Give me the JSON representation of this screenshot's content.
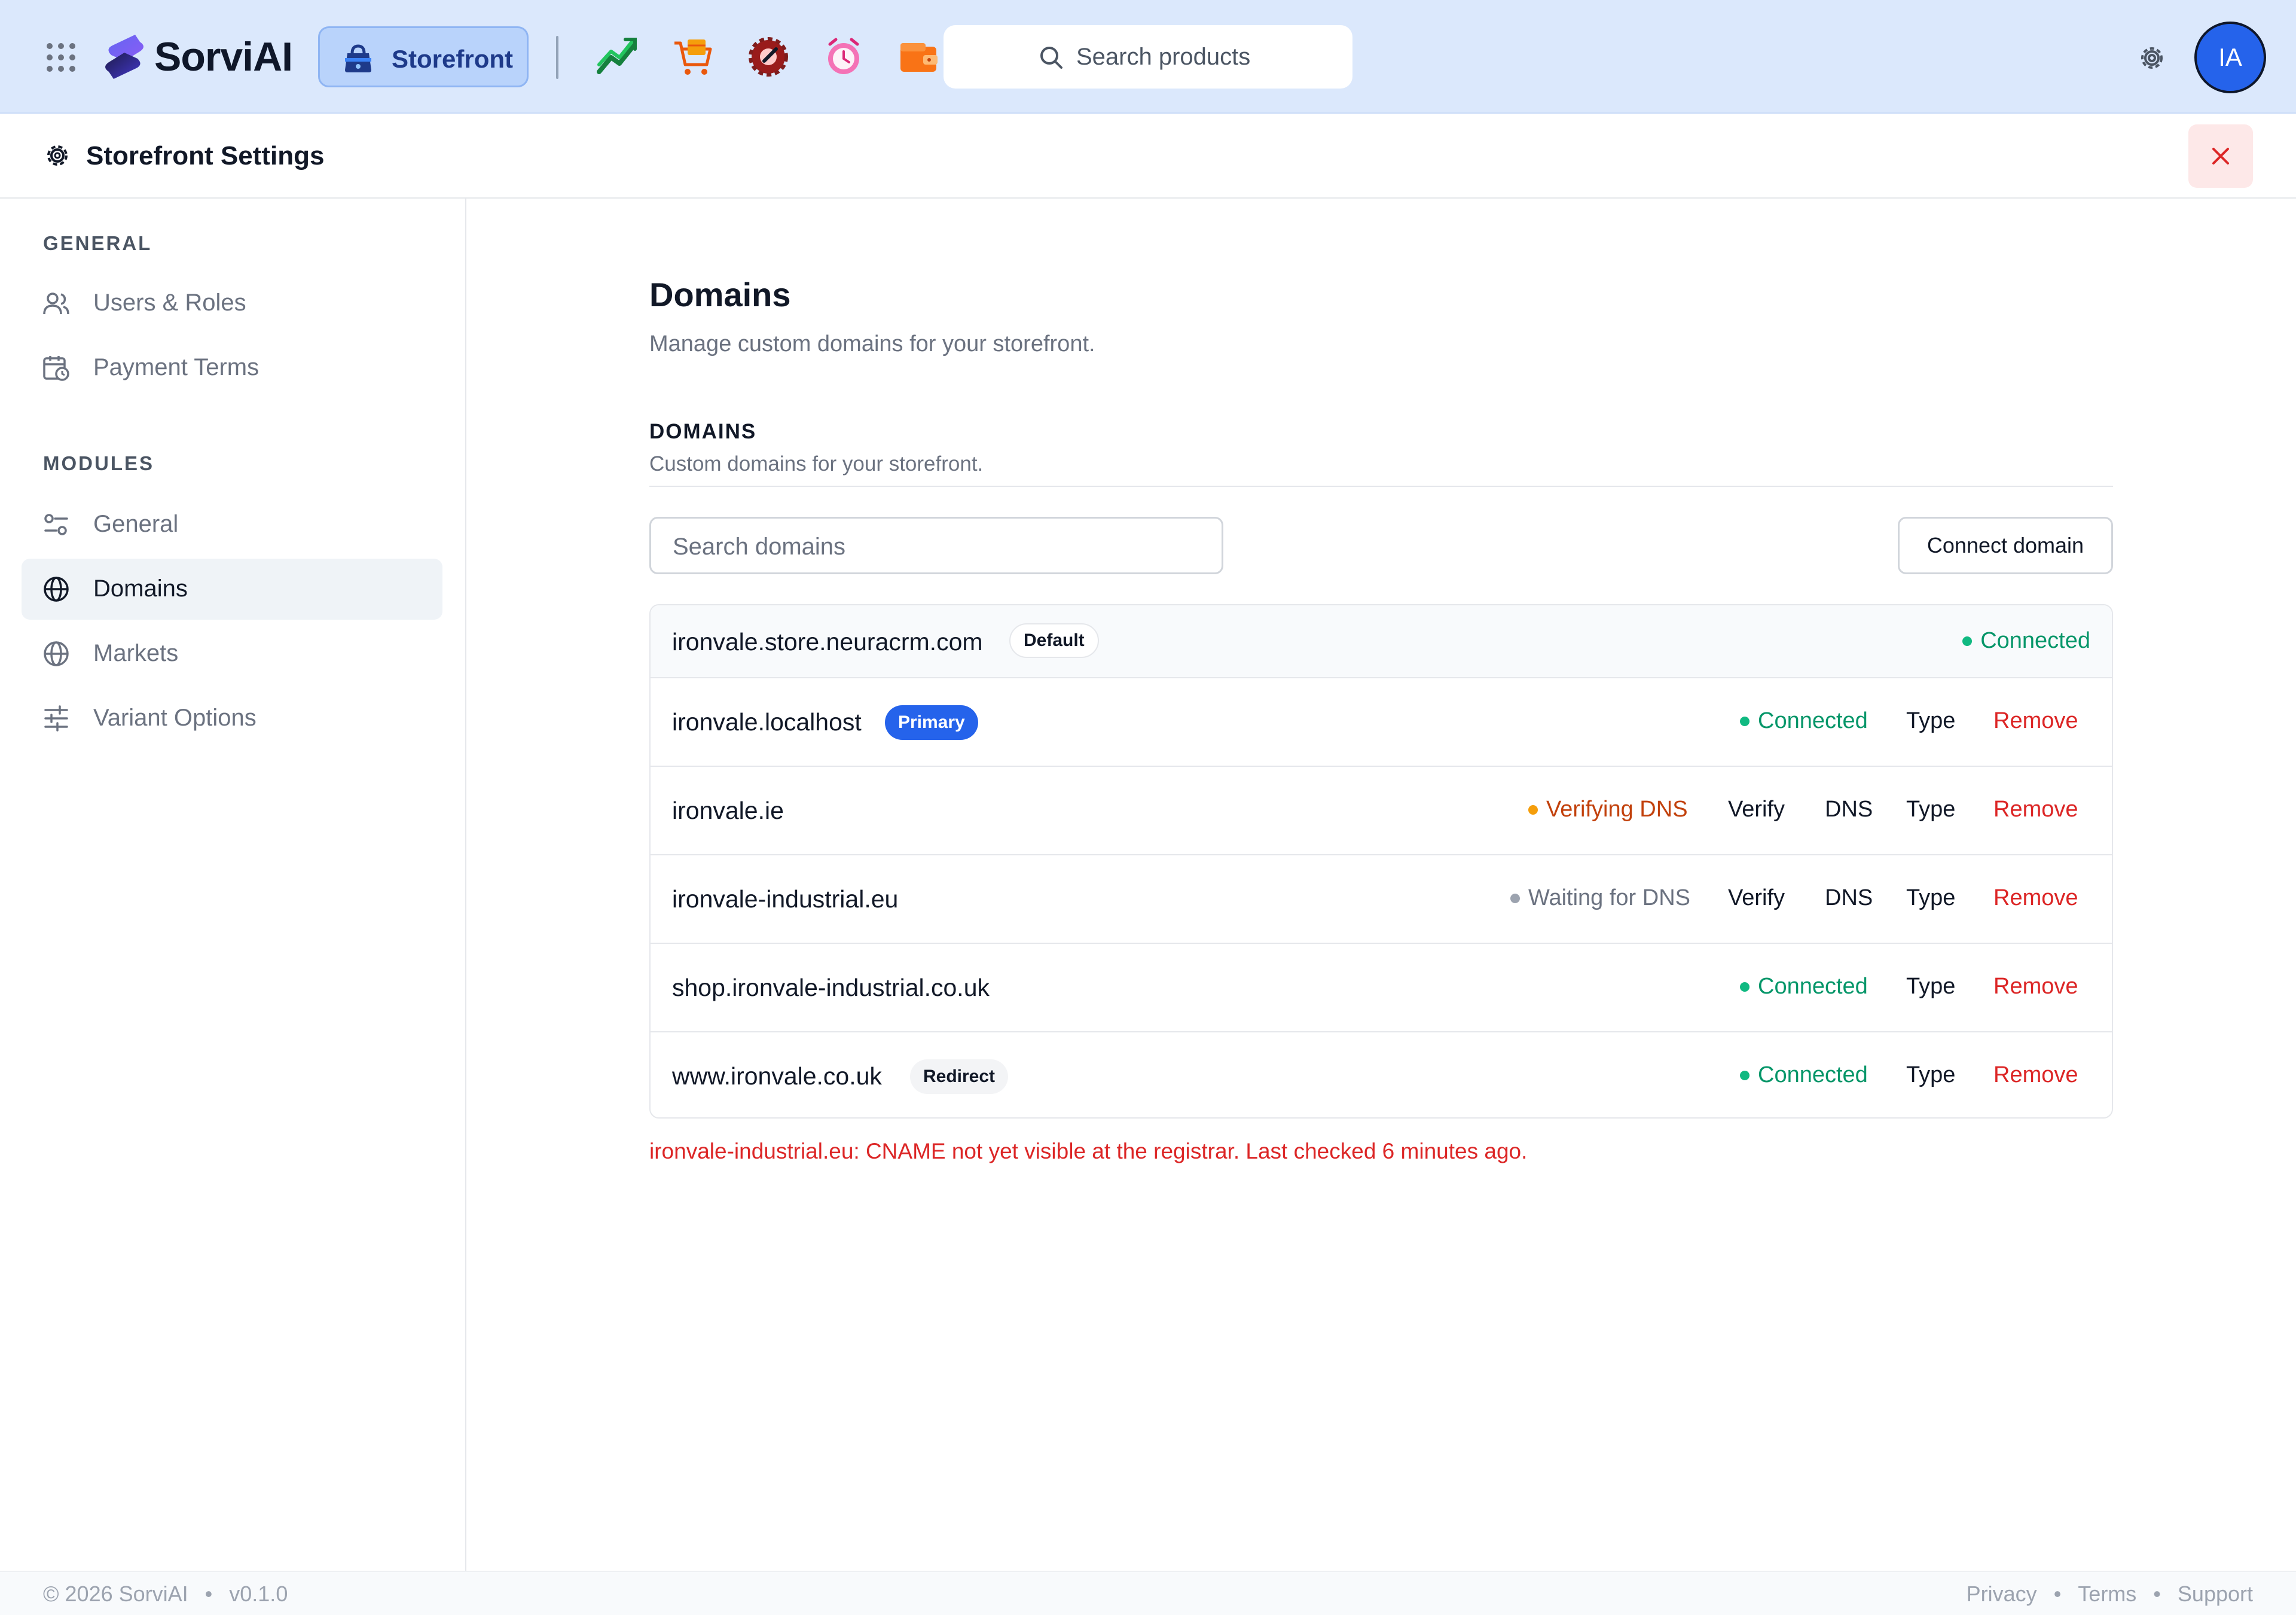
{
  "topbar": {
    "brand": "SorviAI",
    "app_switcher_label": "Storefront",
    "modules": [
      "analytics-icon",
      "cart-icon",
      "service-icon",
      "timer-icon",
      "wallet-icon"
    ],
    "search_placeholder": "Search products",
    "avatar_initials": "IA"
  },
  "header": {
    "title": "Storefront Settings"
  },
  "sidebar": {
    "general_label": "GENERAL",
    "general_items": [
      {
        "label": "Users & Roles",
        "icon": "users-icon"
      },
      {
        "label": "Payment Terms",
        "icon": "calendar-clock-icon"
      }
    ],
    "modules_label": "MODULES",
    "module_items": [
      {
        "label": "General",
        "icon": "toggles-icon"
      },
      {
        "label": "Domains",
        "icon": "globe-icon",
        "active": true
      },
      {
        "label": "Markets",
        "icon": "globe-icon"
      },
      {
        "label": "Variant Options",
        "icon": "sliders-icon"
      }
    ]
  },
  "main": {
    "title": "Domains",
    "subtitle": "Manage custom domains for your storefront.",
    "section_title": "DOMAINS",
    "section_subtitle": "Custom domains for your storefront.",
    "search_placeholder": "Search domains",
    "connect_button": "Connect domain",
    "domains": [
      {
        "name": "ironvale.store.neuracrm.com",
        "badge": "Default",
        "status": "Connected",
        "actions": []
      },
      {
        "name": "ironvale.localhost",
        "badge": "Primary",
        "status": "Connected",
        "actions": [
          "Type",
          "Remove"
        ]
      },
      {
        "name": "ironvale.ie",
        "badge": "",
        "status": "Verifying DNS",
        "actions": [
          "Verify",
          "DNS",
          "Type",
          "Remove"
        ]
      },
      {
        "name": "ironvale-industrial.eu",
        "badge": "",
        "status": "Waiting for DNS",
        "actions": [
          "Verify",
          "DNS",
          "Type",
          "Remove"
        ]
      },
      {
        "name": "shop.ironvale-industrial.co.uk",
        "badge": "",
        "status": "Connected",
        "actions": [
          "Type",
          "Remove"
        ]
      },
      {
        "name": "www.ironvale.co.uk",
        "badge": "Redirect",
        "status": "Connected",
        "actions": [
          "Type",
          "Remove"
        ]
      }
    ],
    "error_message": "ironvale-industrial.eu: CNAME not yet visible at the registrar. Last checked 6 minutes ago."
  },
  "footer": {
    "copyright": "© 2026 SorviAI",
    "version": "v0.1.0",
    "links": [
      "Privacy",
      "Terms",
      "Support"
    ]
  },
  "colors": {
    "topbar_bg": "#dbe8fc",
    "accent": "#2563eb",
    "success": "#059669",
    "warning": "#c2410c",
    "danger": "#dc2626"
  }
}
